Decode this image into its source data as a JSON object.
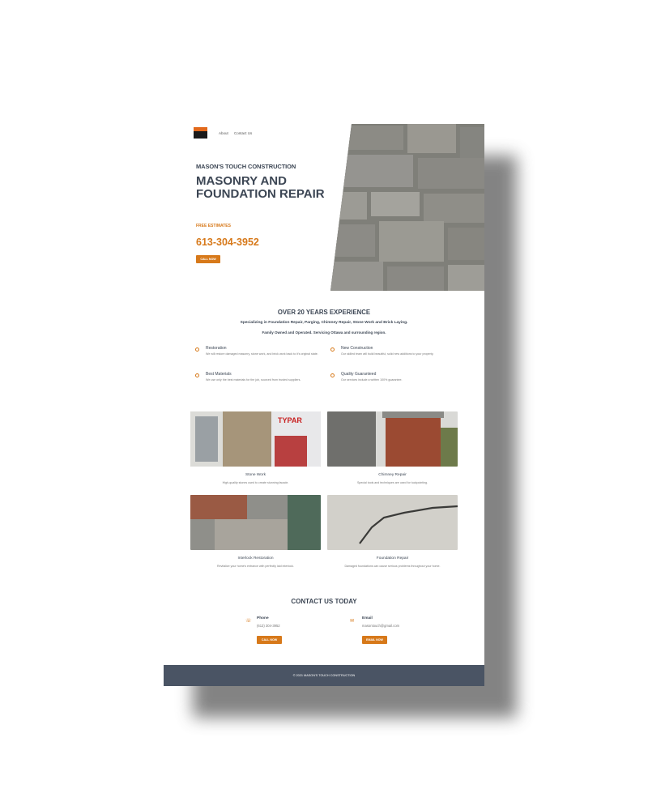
{
  "nav": {
    "items": [
      "About",
      "Contact Us"
    ]
  },
  "hero": {
    "brand": "MASON'S TOUCH CONSTRUCTION",
    "headline": "MASONRY AND FOUNDATION REPAIR",
    "estimates": "FREE ESTIMATES",
    "phone": "613-304-3952",
    "cta": "CALL NOW"
  },
  "experience": {
    "title": "OVER 20 YEARS EXPERIENCE",
    "subtitle": "Specializing in Foundation Repair, Parging, Chimney Repair, Stone Work and Brick Laying.",
    "subtitle2": "Family Owned and Operated. Servicing Ottawa and surrounding region.",
    "features": [
      {
        "title": "Restoration",
        "desc": "We will restore damaged masonry, stone work, and brick work back to it's original state.",
        "icon": "shield-icon"
      },
      {
        "title": "New Construction",
        "desc": "Our skilled team will build beautiful, solid new additions to your property.",
        "icon": "shield-icon"
      },
      {
        "title": "Best Materials",
        "desc": "We use only the best materials for the job, sourced from trusted suppliers.",
        "icon": "shield-icon"
      },
      {
        "title": "Quality Guaranteed",
        "desc": "Our services include a written 100% guarantee.",
        "icon": "shield-icon"
      }
    ]
  },
  "gallery": [
    {
      "title": "Stone Work",
      "desc": "High-quality stones used to create stunning facade."
    },
    {
      "title": "Chimney Repair",
      "desc": "Special tools and techniques are used for tuckpointing."
    },
    {
      "title": "Interlock Restoration",
      "desc": "Revitalize your home's entrance with perfectly laid interlock."
    },
    {
      "title": "Foundation Repair",
      "desc": "Damaged foundations can cause serious problems throughout your home."
    }
  ],
  "contact": {
    "title": "CONTACT US TODAY",
    "phone_label": "Phone",
    "phone_value": "(613) 304-3952",
    "phone_cta": "CALL NOW",
    "email_label": "Email",
    "email_value": "masontouch@gmail.com",
    "email_cta": "EMAIL NOW"
  },
  "footer": {
    "text": "© 2021 MASON'S TOUCH CONSTRUCTION"
  },
  "colors": {
    "accent": "#d7791a",
    "text": "#3c4654",
    "footer": "#4a5464"
  }
}
